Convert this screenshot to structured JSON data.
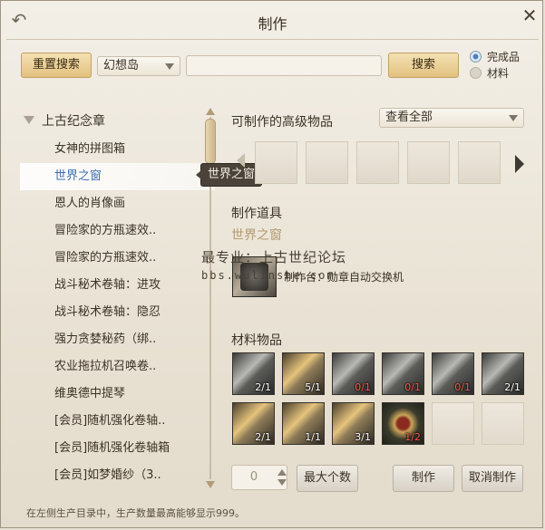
{
  "window": {
    "title": "制作",
    "back_icon": "back-arrow-icon",
    "close_icon": "close-icon"
  },
  "toolbar": {
    "reset_label": "重置搜索",
    "region_value": "幻想岛",
    "search_value": "",
    "search_label": "搜索",
    "radio_options": [
      {
        "label": "完成品",
        "selected": true
      },
      {
        "label": "材料",
        "selected": false
      }
    ]
  },
  "sidebar": {
    "category": "上古纪念章",
    "items": [
      {
        "label": "女神的拼图箱"
      },
      {
        "label": "世界之窗",
        "selected": true
      },
      {
        "label": "恩人的肖像画"
      },
      {
        "label": "冒险家的方瓶速效.."
      },
      {
        "label": "冒险家的方瓶速效.."
      },
      {
        "label": "战斗秘术卷轴：进攻"
      },
      {
        "label": "战斗秘术卷轴：隐忍"
      },
      {
        "label": "强力贪婪秘药（绑.."
      },
      {
        "label": "农业拖拉机召唤卷.."
      },
      {
        "label": "维奥德中提琴"
      },
      {
        "label": "[会员]随机强化卷轴.."
      },
      {
        "label": "[会员]随机强化卷轴箱"
      },
      {
        "label": "[会员]如梦婚纱（3.."
      }
    ],
    "tooltip": "世界之窗"
  },
  "advanced": {
    "label": "可制作的高级物品",
    "view_value": "查看全部",
    "slot_count": 5
  },
  "tools": {
    "label": "制作道具",
    "item_name": "世界之窗",
    "workbench": "制作台：勋章自动交换机"
  },
  "watermark": {
    "line1": "最专业：上古世纪论坛",
    "line2": "bbs.wulinshe.com"
  },
  "materials": {
    "label": "材料物品",
    "slots": [
      {
        "style": "gray",
        "qty": "2/1",
        "short": false
      },
      {
        "style": "gold",
        "qty": "5/1",
        "short": false
      },
      {
        "style": "gray",
        "qty": "0/1",
        "short": true
      },
      {
        "style": "gray",
        "qty": "0/1",
        "short": true
      },
      {
        "style": "gray",
        "qty": "0/1",
        "short": true
      },
      {
        "style": "gray",
        "qty": "2/1",
        "short": false
      },
      {
        "style": "gold",
        "qty": "2/1",
        "short": false
      },
      {
        "style": "gold",
        "qty": "1/1",
        "short": false
      },
      {
        "style": "gold",
        "qty": "3/1",
        "short": false
      },
      {
        "style": "medal",
        "qty": "1/2",
        "short": true
      },
      {
        "style": "empty",
        "qty": "",
        "short": false
      },
      {
        "style": "empty",
        "qty": "",
        "short": false
      }
    ]
  },
  "footer_controls": {
    "quantity": "0",
    "max_label": "最大个数",
    "make_label": "制作",
    "cancel_label": "取消制作"
  },
  "footer_note": "在左侧生产目录中，生产数量最高能够显示999。",
  "colors": {
    "accent_blue": "#3f6fae",
    "gold_button": "#e2c17f",
    "short_qty": "#ff5a4a"
  }
}
